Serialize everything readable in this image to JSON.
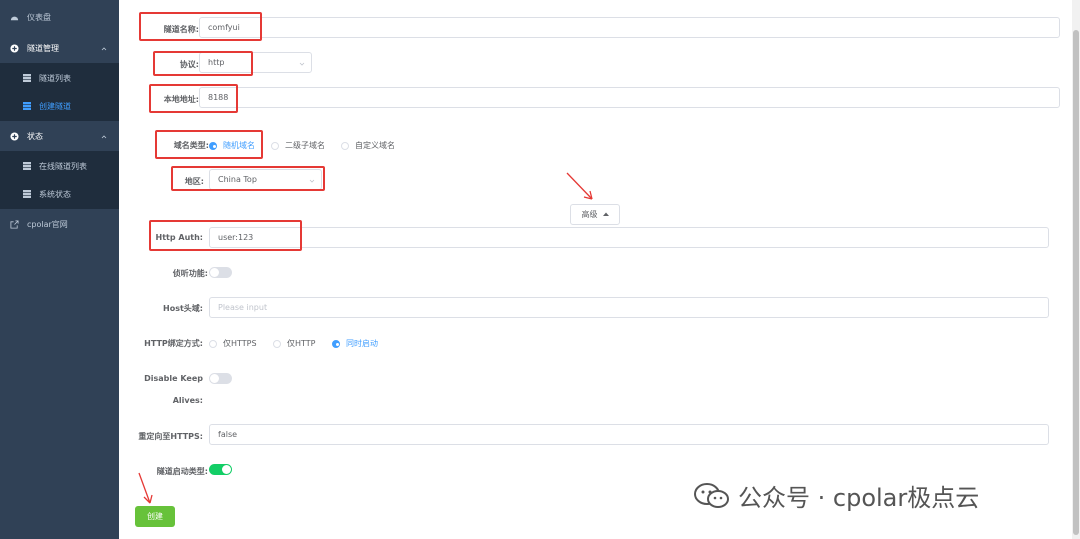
{
  "sidebar": {
    "items": [
      {
        "label": "仪表盘",
        "icon": "dashboard-icon"
      },
      {
        "label": "隧道管理",
        "icon": "plus-circle-icon"
      },
      {
        "label": "隧道列表",
        "icon": "grid-icon"
      },
      {
        "label": "创建隧道",
        "icon": "grid-icon"
      },
      {
        "label": "状态",
        "icon": "plus-circle-icon"
      },
      {
        "label": "在线隧道列表",
        "icon": "grid-icon"
      },
      {
        "label": "系统状态",
        "icon": "grid-icon"
      },
      {
        "label": "cpolar官网",
        "icon": "external-link-icon"
      }
    ]
  },
  "form": {
    "tunnel_name": {
      "label": "隧道名称:",
      "value": "comfyui"
    },
    "protocol": {
      "label": "协议:",
      "value": "http"
    },
    "local_address": {
      "label": "本地地址:",
      "value": "8188"
    },
    "domain_type": {
      "label": "域名类型:",
      "options": [
        "随机域名",
        "二级子域名",
        "自定义域名"
      ],
      "selected": "随机域名"
    },
    "region": {
      "label": "地区:",
      "value": "China Top"
    },
    "advanced_button": "高级",
    "http_auth": {
      "label": "Http Auth:",
      "value": "user:123"
    },
    "listen": {
      "label": "侦听功能:",
      "on": false
    },
    "host_header": {
      "label": "Host头域:",
      "placeholder": "Please input"
    },
    "http_bind": {
      "label": "HTTP绑定方式:",
      "options": [
        "仅HTTPS",
        "仅HTTP",
        "同时启动"
      ],
      "selected": "同时启动"
    },
    "disable_keep_alives": {
      "label_line1": "Disable Keep",
      "label_line2": "Alives:",
      "on": false
    },
    "redirect_https": {
      "label": "重定向至HTTPS:",
      "value": "false"
    },
    "tunnel_start_type": {
      "label": "隧道启动类型:",
      "on": true
    },
    "create_button": "创建"
  },
  "watermark": {
    "text": "公众号 · cpolar极点云"
  },
  "colors": {
    "sidebar": "#304156",
    "accent": "#409eff",
    "annotation": "#e53935",
    "create": "#67c23a",
    "switch_on": "#13ce66"
  }
}
